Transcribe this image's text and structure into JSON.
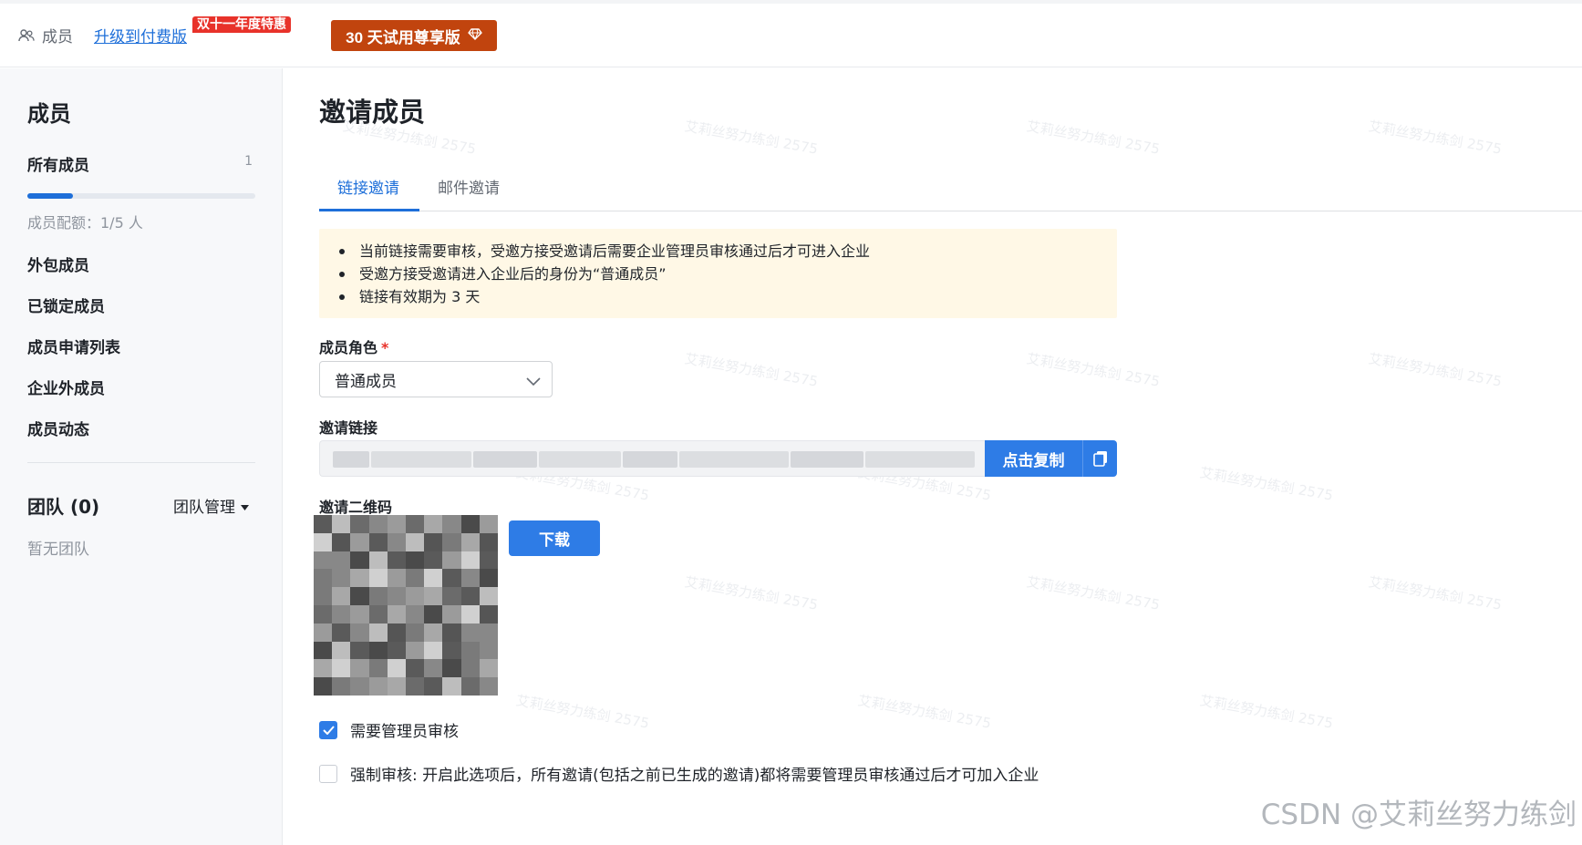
{
  "topbar": {
    "breadcrumb_label": "成员",
    "upgrade_link": "升级到付费版",
    "promo_badge": "双十一年度特惠",
    "trial_button": "30 天试用尊享版"
  },
  "sidebar": {
    "title": "成员",
    "all_members": {
      "label": "所有成员",
      "count": "1"
    },
    "quota_progress": 0.2,
    "quota_text": "成员配额：1/5 人",
    "items": [
      {
        "label": "外包成员"
      },
      {
        "label": "已锁定成员"
      },
      {
        "label": "成员申请列表"
      },
      {
        "label": "企业外成员"
      },
      {
        "label": "成员动态"
      }
    ],
    "team_title": "团队 (0)",
    "team_manage": "团队管理",
    "no_team": "暂无团队"
  },
  "main": {
    "title": "邀请成员",
    "tabs": [
      {
        "label": "链接邀请",
        "active": true
      },
      {
        "label": "邮件邀请",
        "active": false
      }
    ],
    "notice": [
      "当前链接需要审核，受邀方接受邀请后需要企业管理员审核通过后才可进入企业",
      "受邀方接受邀请进入企业后的身份为“普通成员”",
      "链接有效期为 3 天"
    ],
    "role_label": "成员角色",
    "role_required": "*",
    "role_value": "普通成员",
    "link_label": "邀请链接",
    "copy_button": "点击复制",
    "qr_label": "邀请二维码",
    "download_button": "下载",
    "require_admin_review": {
      "label": "需要管理员审核",
      "checked": true
    },
    "force_review": {
      "label": "强制审核: 开启此选项后，所有邀请(包括之前已生成的邀请)都将需要管理员审核通过后才可加入企业",
      "checked": false
    }
  },
  "watermark_text": "艾莉丝努力练剑 2575",
  "footer_watermark": "CSDN @艾莉丝努力练剑",
  "colors": {
    "accent": "#2e7ce6",
    "link": "#1e6fd9",
    "trial_button": "#c1440e",
    "promo_badge": "#e8322a",
    "notice_bg": "#fff8e6",
    "sidebar_bg": "#f7f8fa"
  }
}
